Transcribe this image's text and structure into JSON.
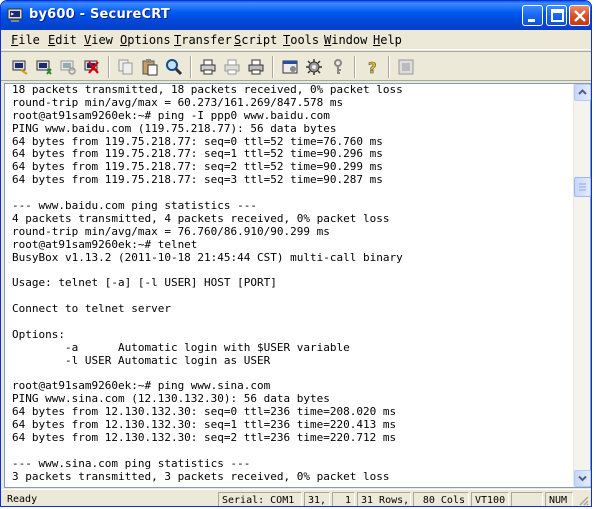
{
  "window": {
    "title": "by600 - SecureCRT"
  },
  "menu": [
    "File",
    "Edit",
    "View",
    "Options",
    "Transfer",
    "Script",
    "Tools",
    "Window",
    "Help"
  ],
  "toolbar": {
    "icons": [
      "connect-icon",
      "quick-connect-icon",
      "reconnect-icon",
      "disconnect-icon",
      "copy-icon",
      "paste-icon",
      "find-icon",
      "print-icon",
      "print-setup-icon",
      "print-icon-2",
      "session-options-icon",
      "global-options-icon",
      "key-icon",
      "help-icon",
      "sftp-icon"
    ]
  },
  "terminal": {
    "lines": [
      "18 packets transmitted, 18 packets received, 0% packet loss",
      "round-trip min/avg/max = 60.273/161.269/847.578 ms",
      "root@at91sam9260ek:~# ping -I ppp0 www.baidu.com",
      "PING www.baidu.com (119.75.218.77): 56 data bytes",
      "64 bytes from 119.75.218.77: seq=0 ttl=52 time=76.760 ms",
      "64 bytes from 119.75.218.77: seq=1 ttl=52 time=90.296 ms",
      "64 bytes from 119.75.218.77: seq=2 ttl=52 time=90.299 ms",
      "64 bytes from 119.75.218.77: seq=3 ttl=52 time=90.287 ms",
      "",
      "--- www.baidu.com ping statistics ---",
      "4 packets transmitted, 4 packets received, 0% packet loss",
      "round-trip min/avg/max = 76.760/86.910/90.299 ms",
      "root@at91sam9260ek:~# telnet",
      "BusyBox v1.13.2 (2011-10-18 21:45:44 CST) multi-call binary",
      "",
      "Usage: telnet [-a] [-l USER] HOST [PORT]",
      "",
      "Connect to telnet server",
      "",
      "Options:",
      "        -a      Automatic login with $USER variable",
      "        -l USER Automatic login as USER",
      "",
      "root@at91sam9260ek:~# ping www.sina.com",
      "PING www.sina.com (12.130.132.30): 56 data bytes",
      "64 bytes from 12.130.132.30: seq=0 ttl=236 time=208.020 ms",
      "64 bytes from 12.130.132.30: seq=1 ttl=236 time=220.413 ms",
      "64 bytes from 12.130.132.30: seq=2 ttl=236 time=220.712 ms",
      "",
      "--- www.sina.com ping statistics ---",
      "3 packets transmitted, 3 packets received, 0% packet loss"
    ]
  },
  "status": {
    "ready": "Ready",
    "serial": "Serial: COM1",
    "row": "31,",
    "col": "1",
    "rows": "31 Rows,",
    "cols": "80 Cols",
    "term": "VT100",
    "num": "NUM"
  },
  "colors": {
    "title_bar": "#0054e3",
    "window_bg": "#ece9d8",
    "terminal_bg": "#ffffff",
    "close_button": "#d8512b"
  }
}
